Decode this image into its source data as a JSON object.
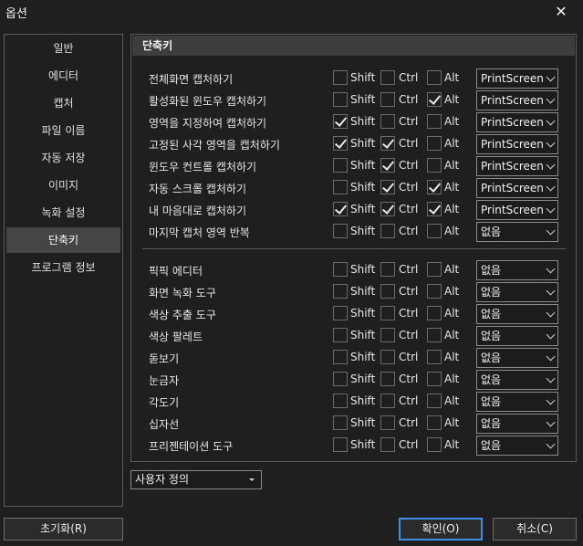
{
  "window": {
    "title": "옵션",
    "close_glyph": "✕"
  },
  "sidebar": {
    "items": [
      {
        "label": "일반",
        "active": false
      },
      {
        "label": "에디터",
        "active": false
      },
      {
        "label": "캡처",
        "active": false
      },
      {
        "label": "파일 이름",
        "active": false
      },
      {
        "label": "자동 저장",
        "active": false
      },
      {
        "label": "이미지",
        "active": false
      },
      {
        "label": "녹화 설정",
        "active": false
      },
      {
        "label": "단축키",
        "active": true
      },
      {
        "label": "프로그램 정보",
        "active": false
      }
    ]
  },
  "panel": {
    "title": "단축키",
    "mod_labels": {
      "shift": "Shift",
      "ctrl": "Ctrl",
      "alt": "Alt"
    },
    "group1": [
      {
        "label": "전체화면 캡처하기",
        "shift": false,
        "ctrl": false,
        "alt": false,
        "key": "PrintScreen"
      },
      {
        "label": "활성화된 윈도우 캡처하기",
        "shift": false,
        "ctrl": false,
        "alt": true,
        "key": "PrintScreen"
      },
      {
        "label": "영역을 지정하여 캡처하기",
        "shift": true,
        "ctrl": false,
        "alt": false,
        "key": "PrintScreen"
      },
      {
        "label": "고정된 사각 영역을 캡처하기",
        "shift": true,
        "ctrl": true,
        "alt": false,
        "key": "PrintScreen"
      },
      {
        "label": "윈도우 컨트롤 캡처하기",
        "shift": false,
        "ctrl": true,
        "alt": false,
        "key": "PrintScreen"
      },
      {
        "label": "자동 스크롤 캡처하기",
        "shift": false,
        "ctrl": true,
        "alt": true,
        "key": "PrintScreen"
      },
      {
        "label": "내 마음대로 캡처하기",
        "shift": true,
        "ctrl": true,
        "alt": true,
        "key": "PrintScreen"
      },
      {
        "label": "마지막 캡처 영역 반복",
        "shift": false,
        "ctrl": false,
        "alt": false,
        "key": "없음"
      }
    ],
    "group2": [
      {
        "label": "픽픽 에디터",
        "shift": false,
        "ctrl": false,
        "alt": false,
        "key": "없음"
      },
      {
        "label": "화면 녹화 도구",
        "shift": false,
        "ctrl": false,
        "alt": false,
        "key": "없음"
      },
      {
        "label": "색상 추출 도구",
        "shift": false,
        "ctrl": false,
        "alt": false,
        "key": "없음"
      },
      {
        "label": "색상 팔레트",
        "shift": false,
        "ctrl": false,
        "alt": false,
        "key": "없음"
      },
      {
        "label": "돋보기",
        "shift": false,
        "ctrl": false,
        "alt": false,
        "key": "없음"
      },
      {
        "label": "눈금자",
        "shift": false,
        "ctrl": false,
        "alt": false,
        "key": "없음"
      },
      {
        "label": "각도기",
        "shift": false,
        "ctrl": false,
        "alt": false,
        "key": "없음"
      },
      {
        "label": "십자선",
        "shift": false,
        "ctrl": false,
        "alt": false,
        "key": "없음"
      },
      {
        "label": "프리젠테이션 도구",
        "shift": false,
        "ctrl": false,
        "alt": false,
        "key": "없음"
      }
    ]
  },
  "preset": {
    "value": "사용자 정의"
  },
  "buttons": {
    "reset": "초기화(R)",
    "ok": "확인(O)",
    "cancel": "취소(C)"
  },
  "colors": {
    "background": "#1f1f1f",
    "selected": "#454545",
    "focus_border": "#3d8fe6"
  }
}
